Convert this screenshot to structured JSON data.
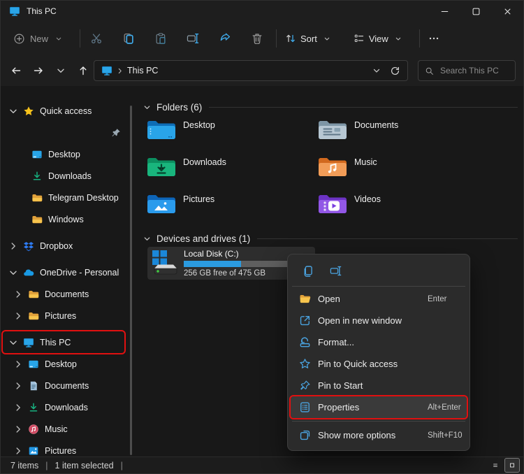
{
  "colors": {
    "accent_blue": "#4aa3e0",
    "highlight_red": "#e01010",
    "progress_fill": "#2b9be0",
    "folder_yellow": "#f7c44d"
  },
  "titlebar": {
    "title": "This PC",
    "app_icon": "monitor",
    "controls": [
      {
        "name": "minimize-button",
        "icon": "win-min"
      },
      {
        "name": "maximize-button",
        "icon": "win-max"
      },
      {
        "name": "close-button",
        "icon": "win-close"
      }
    ]
  },
  "toolbar": {
    "new_label": "New",
    "buttons": [
      {
        "name": "cut-button",
        "icon": "cut"
      },
      {
        "name": "copy-button",
        "icon": "copy-toolbar"
      },
      {
        "name": "paste-button",
        "icon": "paste"
      },
      {
        "name": "rename-button",
        "icon": "rename-toolbar"
      },
      {
        "name": "share-button",
        "icon": "share"
      },
      {
        "name": "delete-button",
        "icon": "trash"
      }
    ],
    "sort_label": "Sort",
    "view_label": "View"
  },
  "addressbar": {
    "path": "This PC",
    "search_placeholder": "Search This PC",
    "nav": [
      {
        "name": "back-button",
        "icon": "back-arrow"
      },
      {
        "name": "forward-button",
        "icon": "forward-arrow"
      },
      {
        "name": "recent-locations-button",
        "icon": "chevron-down"
      },
      {
        "name": "up-button",
        "icon": "up-arrow"
      }
    ]
  },
  "sidebar": {
    "items": [
      {
        "name": "sidebar-item-quick-access",
        "label": "Quick access",
        "icon": "star",
        "chevron": "chevron-down",
        "level": "top"
      },
      {
        "name": "sidebar-pin-row",
        "label": "",
        "icon": "",
        "chevron": "",
        "level": "qa",
        "trailing": "pin"
      },
      {
        "name": "sidebar-item-desktop-qa",
        "label": "Desktop",
        "icon": "desktop-blue",
        "chevron": "",
        "level": "qa"
      },
      {
        "name": "sidebar-item-downloads-qa",
        "label": "Downloads",
        "icon": "download-green",
        "chevron": "",
        "level": "qa"
      },
      {
        "name": "sidebar-item-telegram-desktop",
        "label": "Telegram Desktop",
        "icon": "folder-yellow",
        "chevron": "",
        "level": "qa"
      },
      {
        "name": "sidebar-item-windows",
        "label": "Windows",
        "icon": "folder-yellow",
        "chevron": "",
        "level": "qa"
      },
      {
        "name": "sidebar-item-dropbox",
        "label": "Dropbox",
        "icon": "dropbox",
        "chevron": "chevron-right",
        "level": "top",
        "gap": "7"
      },
      {
        "name": "sidebar-item-onedrive",
        "label": "OneDrive - Personal",
        "icon": "onedrive",
        "chevron": "chevron-down",
        "level": "top",
        "gap": "7"
      },
      {
        "name": "sidebar-item-documents-od",
        "label": "Documents",
        "icon": "folder-yellow",
        "chevron": "chevron-right",
        "level": "child"
      },
      {
        "name": "sidebar-item-pictures-od",
        "label": "Pictures",
        "icon": "folder-yellow",
        "chevron": "chevron-right",
        "level": "child"
      },
      {
        "name": "sidebar-item-this-pc",
        "label": "This PC",
        "icon": "monitor",
        "chevron": "chevron-down",
        "level": "top",
        "gap": "7",
        "highlight": "true"
      },
      {
        "name": "sidebar-item-desktop-pc",
        "label": "Desktop",
        "icon": "desktop-blue",
        "chevron": "chevron-right",
        "level": "child"
      },
      {
        "name": "sidebar-item-documents-pc",
        "label": "Documents",
        "icon": "doc-blue",
        "chevron": "chevron-right",
        "level": "child"
      },
      {
        "name": "sidebar-item-downloads-pc",
        "label": "Downloads",
        "icon": "download-green",
        "chevron": "chevron-right",
        "level": "child"
      },
      {
        "name": "sidebar-item-music-pc",
        "label": "Music",
        "icon": "music-circle",
        "chevron": "chevron-right",
        "level": "child"
      },
      {
        "name": "sidebar-item-pictures-pc",
        "label": "Pictures",
        "icon": "pictures-blue",
        "chevron": "chevron-right",
        "level": "child"
      }
    ]
  },
  "content": {
    "sections": [
      {
        "title": "Folders (6)"
      },
      {
        "title": "Devices and drives (1)"
      }
    ],
    "folders": [
      {
        "name": "tile-desktop",
        "label": "Desktop",
        "icon": "folder-desktop-big"
      },
      {
        "name": "tile-documents",
        "label": "Documents",
        "icon": "folder-documents-big"
      },
      {
        "name": "tile-downloads",
        "label": "Downloads",
        "icon": "folder-downloads-big"
      },
      {
        "name": "tile-music",
        "label": "Music",
        "icon": "folder-music-big"
      },
      {
        "name": "tile-pictures",
        "label": "Pictures",
        "icon": "folder-pictures-big"
      },
      {
        "name": "tile-videos",
        "label": "Videos",
        "icon": "folder-videos-big"
      }
    ],
    "drive": {
      "name": "Local Disk (C:)",
      "detail": "256 GB free of 475 GB",
      "used_pct": 46
    }
  },
  "context_menu": {
    "quick_icons": [
      {
        "name": "menu-copy-button",
        "icon": "copy-menu"
      },
      {
        "name": "menu-rename-button",
        "icon": "rename-menu"
      }
    ],
    "items": [
      {
        "name": "menu-item-open",
        "label": "Open",
        "shortcut": "Enter",
        "icon": "folder-open"
      },
      {
        "name": "menu-item-open-new-window",
        "label": "Open in new window",
        "shortcut": "",
        "icon": "open-new-window"
      },
      {
        "name": "menu-item-format",
        "label": "Format...",
        "shortcut": "",
        "icon": "format"
      },
      {
        "name": "menu-item-pin-quick-access",
        "label": "Pin to Quick access",
        "shortcut": "",
        "icon": "star-outline"
      },
      {
        "name": "menu-item-pin-start",
        "label": "Pin to Start",
        "shortcut": "",
        "icon": "pin-outline"
      },
      {
        "name": "menu-item-properties",
        "label": "Properties",
        "shortcut": "Alt+Enter",
        "icon": "properties",
        "highlight": "true"
      }
    ],
    "footer": {
      "name": "menu-item-show-more-options",
      "label": "Show more options",
      "shortcut": "Shift+F10",
      "icon": "show-more"
    }
  },
  "statusbar": {
    "count": "7 items",
    "selected": "1 item selected",
    "sep": "|",
    "view_buttons": [
      {
        "name": "details-view-button",
        "icon": "details-view",
        "selected": ""
      },
      {
        "name": "thumbnail-view-button",
        "icon": "thumb-view",
        "selected": "true"
      }
    ]
  }
}
